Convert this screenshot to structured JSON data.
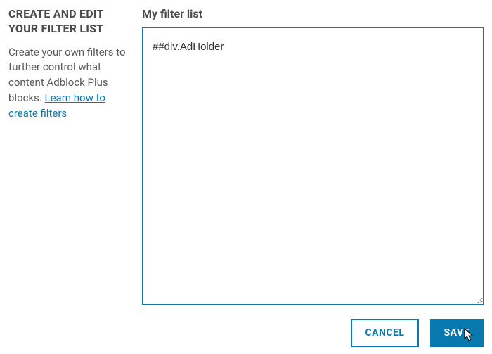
{
  "sidebar": {
    "heading": "CREATE AND EDIT YOUR FILTER LIST",
    "description_pre": "Create your own filters to further control what content Adblock Plus blocks. ",
    "link_text": "Learn how to create filters"
  },
  "main": {
    "heading": "My filter list",
    "filter_value": "##div.AdHolder"
  },
  "buttons": {
    "cancel": "CANCEL",
    "save": "SAVE"
  },
  "colors": {
    "accent": "#0779ae",
    "text": "#4a4a4a"
  }
}
